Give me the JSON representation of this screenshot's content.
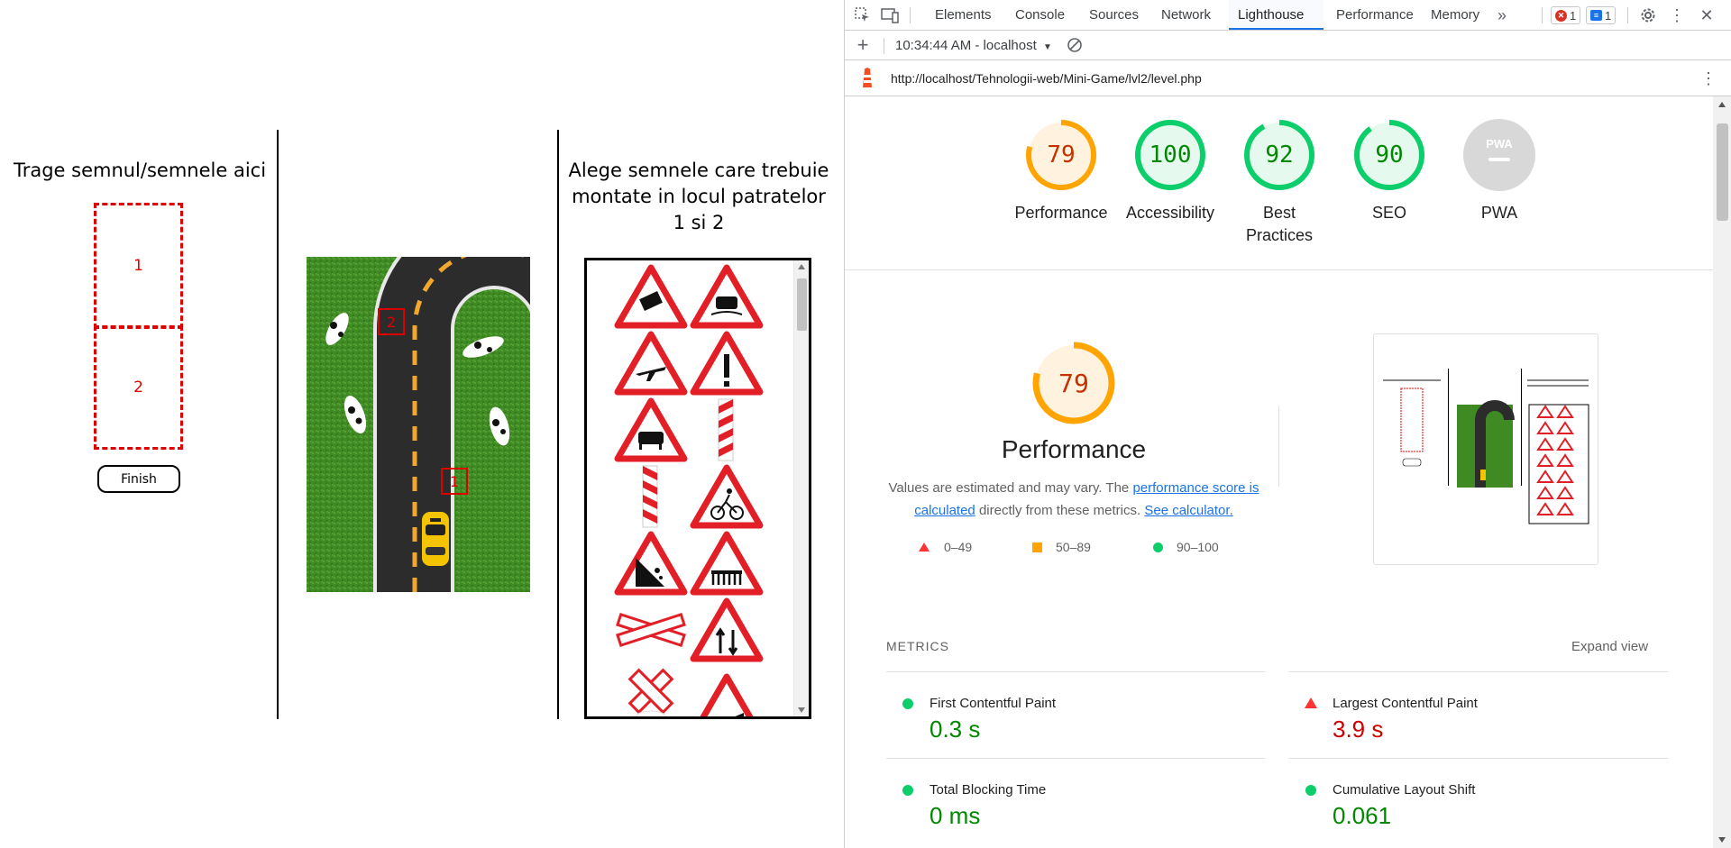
{
  "game": {
    "drop_title": "Trage semnul/semnele aici",
    "choose_title": "Alege semnele care trebuie montate in locul patratelor 1 si 2",
    "slot1": "1",
    "slot2": "2",
    "finish_label": "Finish",
    "road_markers": [
      "2",
      "1"
    ]
  },
  "devtools": {
    "tabs": [
      "Elements",
      "Console",
      "Sources",
      "Network",
      "Lighthouse",
      "Performance",
      "Memory"
    ],
    "active_tab": "Lighthouse",
    "more_tabs": "»",
    "error_count": "1",
    "message_count": "1",
    "report_selector": "10:34:44 AM - localhost",
    "url": "http://localhost/Tehnologii-web/Mini-Game/lvl2/level.php"
  },
  "lighthouse": {
    "gauges": [
      {
        "score": "79",
        "label": "Performance",
        "fraction": 0.79,
        "color": "#ffa400",
        "text_color": "#c33300",
        "bg": "#fff3e0"
      },
      {
        "score": "100",
        "label": "Accessibility",
        "fraction": 1.0,
        "color": "#0cce6b",
        "text_color": "#008800",
        "bg": "#e6f9ee"
      },
      {
        "score": "92",
        "label": "Best Practices",
        "fraction": 0.92,
        "color": "#0cce6b",
        "text_color": "#008800",
        "bg": "#e6f9ee"
      },
      {
        "score": "90",
        "label": "SEO",
        "fraction": 0.9,
        "color": "#0cce6b",
        "text_color": "#008800",
        "bg": "#e6f9ee"
      },
      {
        "score": "PWA",
        "label": "PWA",
        "fraction": 0,
        "color": "#cccccc",
        "text_color": "#ffffff",
        "bg": "#d8d8d8"
      }
    ],
    "perf": {
      "score": "79",
      "title": "Performance",
      "desc_pre": "Values are estimated and may vary. The",
      "link1": "performance score is calculated",
      "desc_mid": "directly from these metrics.",
      "link2": "See calculator."
    },
    "legend": [
      {
        "range": "0–49",
        "shape": "triangle",
        "color": "#ff3333"
      },
      {
        "range": "50–89",
        "shape": "square",
        "color": "#ffa400"
      },
      {
        "range": "90–100",
        "shape": "circle",
        "color": "#0cce6b"
      }
    ],
    "metrics_header": "METRICS",
    "expand_view": "Expand view",
    "metrics": [
      {
        "title": "First Contentful Paint",
        "value": "0.3 s",
        "status": "pass"
      },
      {
        "title": "Largest Contentful Paint",
        "value": "3.9 s",
        "status": "fail"
      },
      {
        "title": "Total Blocking Time",
        "value": "0 ms",
        "status": "pass"
      },
      {
        "title": "Cumulative Layout Shift",
        "value": "0.061",
        "status": "pass"
      }
    ],
    "colors": {
      "pass": "#008800",
      "fail": "#cc0000",
      "pass_dot": "#0cce6b",
      "fail_dot": "#ff3333"
    }
  }
}
